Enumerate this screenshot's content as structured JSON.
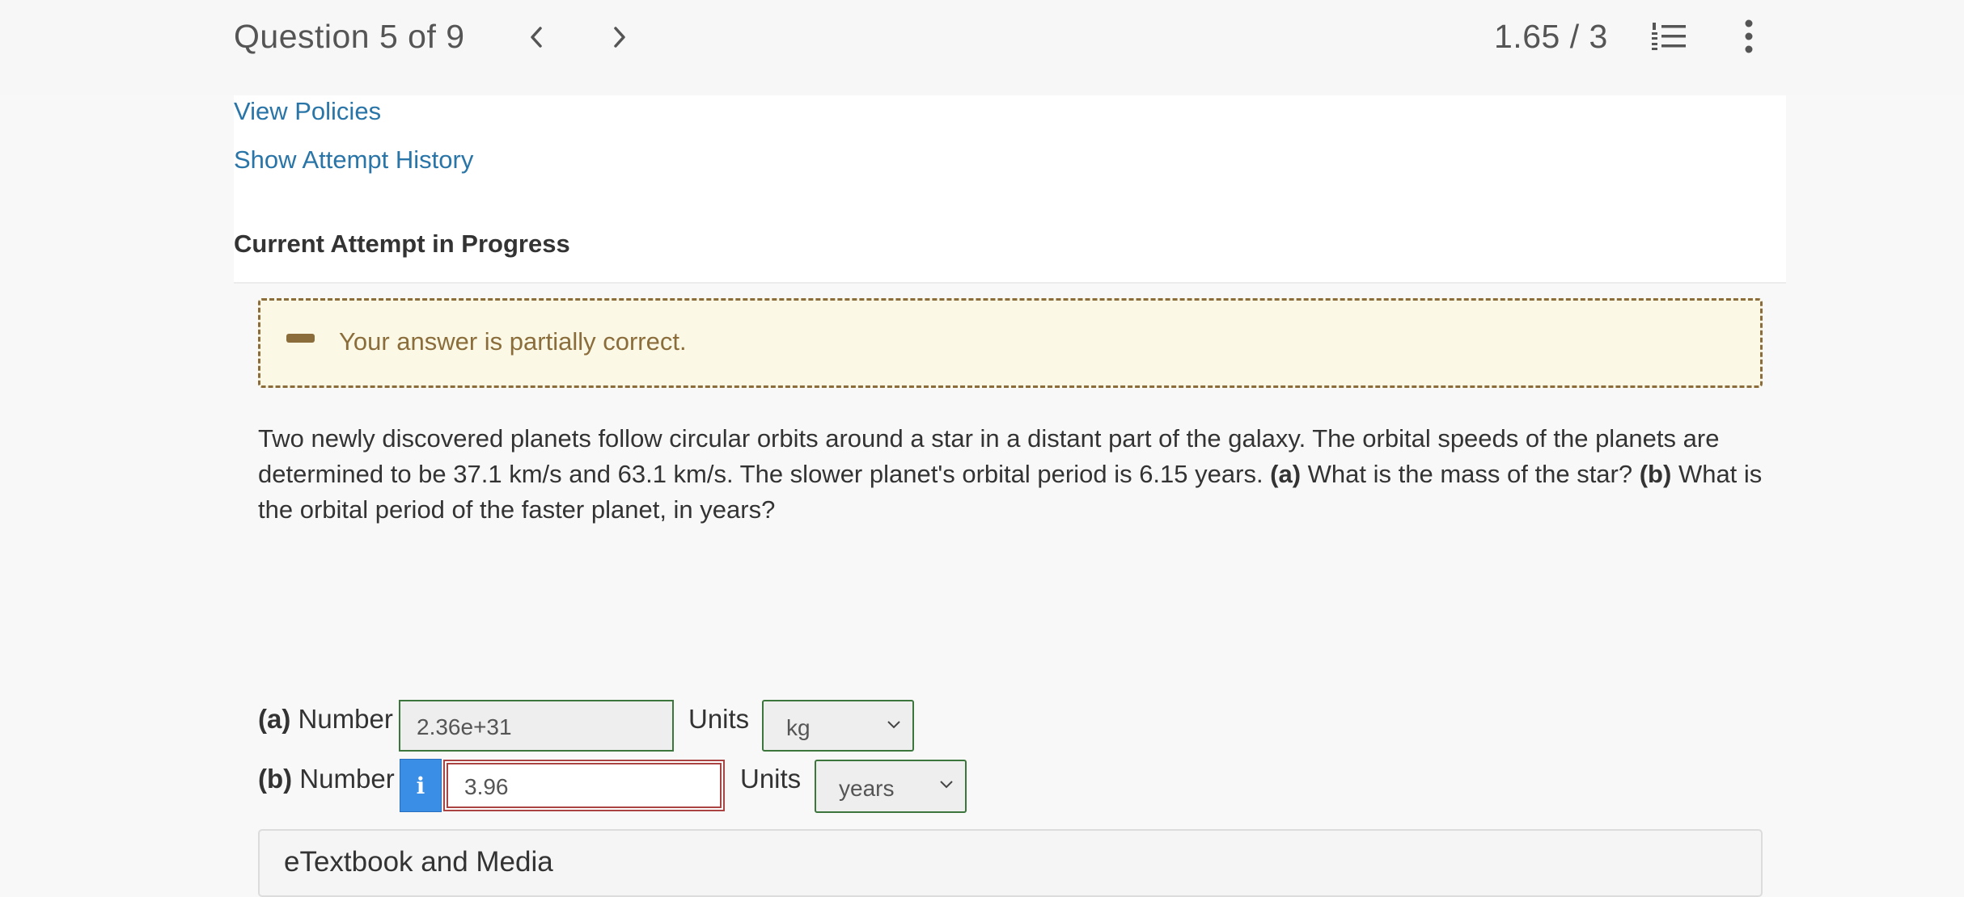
{
  "header": {
    "question_title": "Question 5 of 9",
    "score": "1.65 / 3"
  },
  "links": {
    "view_policies": "View Policies",
    "show_attempt_history": "Show Attempt History"
  },
  "section_heading": "Current Attempt in Progress",
  "feedback": {
    "text": "Your answer is partially correct."
  },
  "problem": {
    "text_before_a": "Two newly discovered planets follow circular orbits around a star in a distant part of the galaxy. The orbital speeds of the planets are determined to be 37.1 km/s and 63.1 km/s. The slower planet's orbital period is 6.15 years. ",
    "part_a_marker": "(a)",
    "part_a_question": " What is the mass of the star? ",
    "part_b_marker": "(b)",
    "part_b_question": " What is the orbital period of the faster planet, in years?"
  },
  "answers": {
    "a": {
      "marker": "(a)",
      "label": " Number",
      "value": "2.36e+31",
      "units_label": "Units",
      "unit": "kg"
    },
    "b": {
      "marker": "(b)",
      "label": " Number",
      "info": "i",
      "value": "3.96",
      "units_label": "Units",
      "unit": "years"
    }
  },
  "etextbook": {
    "label": "eTextbook and Media"
  },
  "icons": {
    "prev": "chevron-left-icon",
    "next": "chevron-right-icon",
    "list": "numbered-list-icon",
    "more": "more-vertical-icon",
    "feedback": "minus-icon"
  },
  "colors": {
    "link": "#2a75a8",
    "partial_feedback": "#8a6d3b",
    "feedback_bg": "#fbf8e5",
    "correct_border": "#3c763d",
    "incorrect_border": "#a94442",
    "info_button": "#3a8ee6"
  }
}
